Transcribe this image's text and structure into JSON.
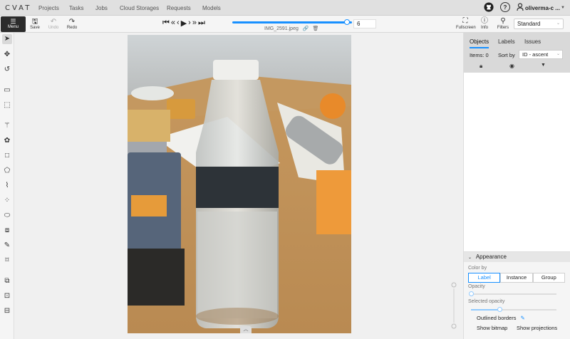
{
  "app": {
    "logo": "CVAT"
  },
  "nav": {
    "projects": "Projects",
    "tasks": "Tasks",
    "jobs": "Jobs",
    "cloud": "Cloud Storages",
    "requests": "Requests",
    "models": "Models"
  },
  "user": {
    "name": "oliverma-c ..."
  },
  "toolbar": {
    "menu": "Menu",
    "save": "Save",
    "undo": "Undo",
    "redo": "Redo",
    "fullscreen": "Fullscreen",
    "info": "Info",
    "filters": "Filters",
    "view_mode": "Standard"
  },
  "player": {
    "frame": "6",
    "filename": "IMG_2591.jpeg",
    "progress": 0.96
  },
  "sidebar": {
    "tabs": {
      "objects": "Objects",
      "labels": "Labels",
      "issues": "Issues"
    },
    "items_label": "Items: 0",
    "sort_by": "Sort by",
    "sort_value": "ID - ascent"
  },
  "appearance": {
    "title": "Appearance",
    "color_by": "Color by",
    "options": {
      "label": "Label",
      "instance": "Instance",
      "group": "Group"
    },
    "opacity": "Opacity",
    "opacity_value": 0.0,
    "selected_opacity": "Selected opacity",
    "selected_opacity_value": 0.33,
    "outlined_borders": "Outlined borders",
    "show_bitmap": "Show bitmap",
    "show_projections": "Show projections"
  },
  "icons": {
    "github": "github-icon",
    "help": "question-icon",
    "user": "user-icon"
  },
  "colors": {
    "accent": "#1890ff",
    "menu_bg": "#2b2b2b"
  }
}
